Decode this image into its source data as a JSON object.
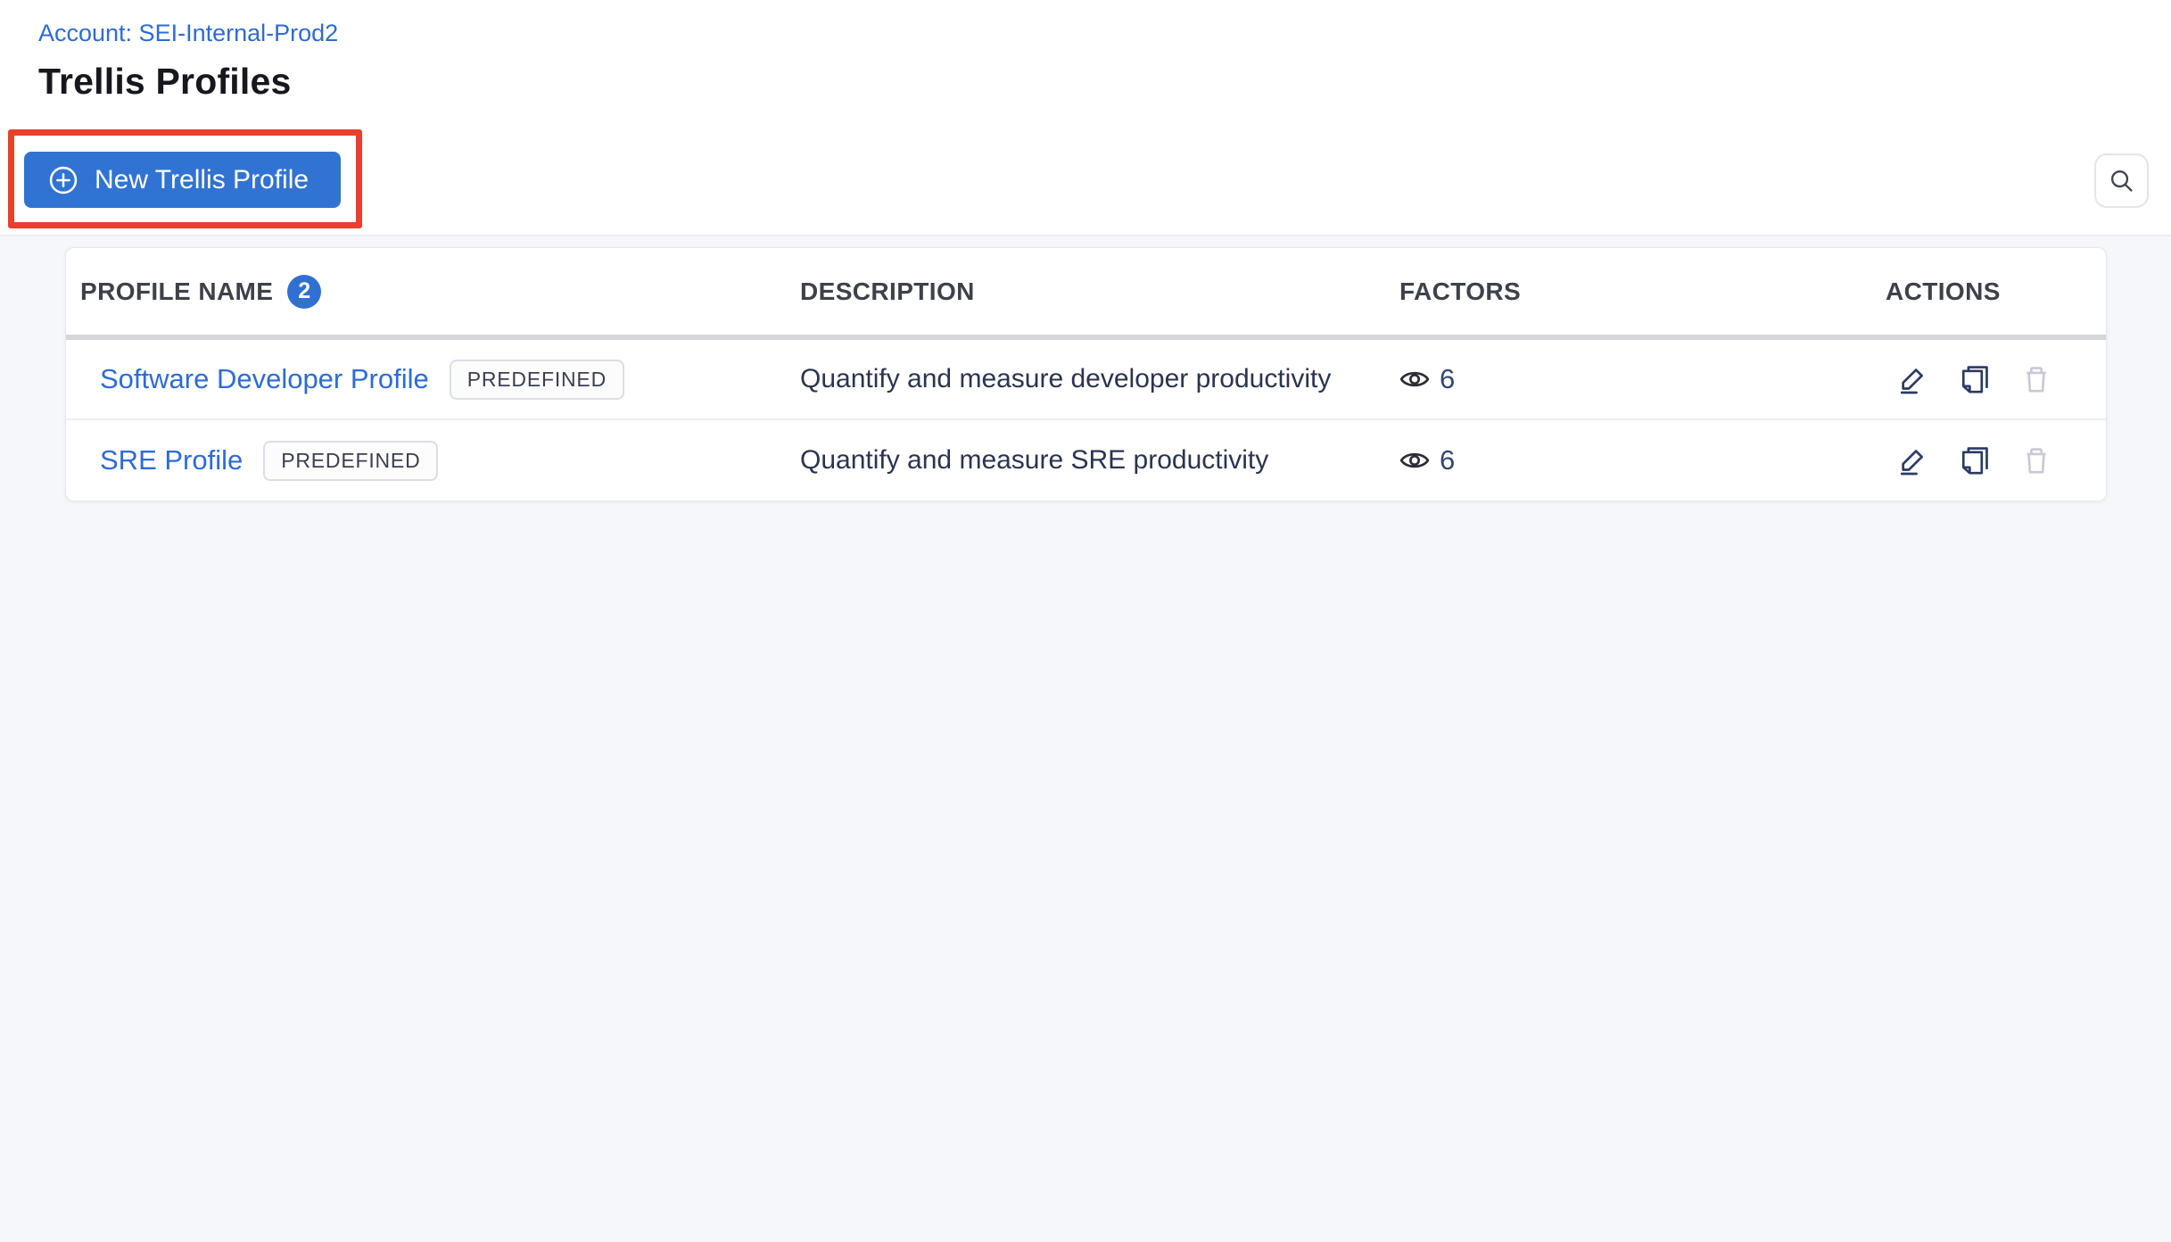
{
  "page": {
    "account_label": "Account: SEI-Internal-Prod2",
    "title": "Trellis Profiles"
  },
  "toolbar": {
    "new_profile_button": "New Trellis Profile"
  },
  "table": {
    "columns": [
      "PROFILE NAME",
      "DESCRIPTION",
      "FACTORS",
      "ACTIONS"
    ],
    "profile_count": "2",
    "rows": [
      {
        "name": "Software Developer Profile",
        "tag": "PREDEFINED",
        "description": "Quantify and measure developer productivity",
        "factors": "6"
      },
      {
        "name": "SRE Profile",
        "tag": "PREDEFINED",
        "description": "Quantify and measure SRE productivity",
        "factors": "6"
      }
    ]
  },
  "icons": {
    "new_profile": "plus-circle-icon",
    "search": "search-icon",
    "factors": "eye-icon",
    "edit": "edit-pencil-icon",
    "copy": "copy-icon",
    "delete": "trash-icon"
  },
  "colors": {
    "primary_button": "#3173d2",
    "link_blue": "#2e6bd6",
    "annotation_red": "#e8402c",
    "count_badge_blue": "#3070d2",
    "icon_navy": "#2b3a63",
    "icon_disabled_gray": "#c8cad3",
    "content_background": "#f6f7fa",
    "header_rule_gray": "#d5d6da"
  }
}
